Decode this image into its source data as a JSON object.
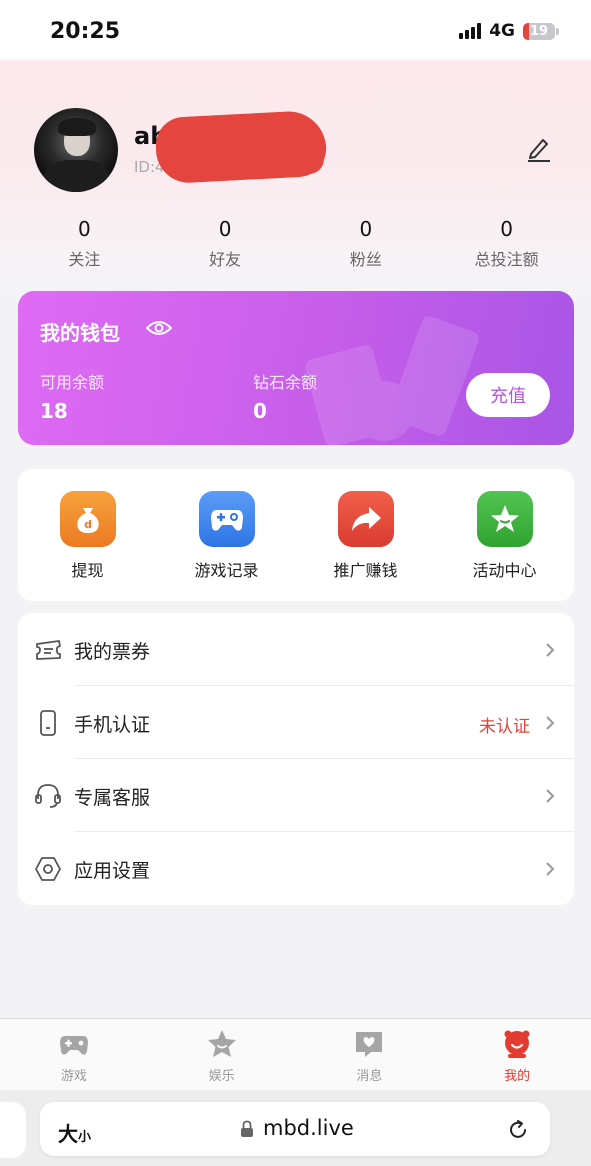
{
  "status_bar": {
    "time": "20:25",
    "network": "4G",
    "battery": "19",
    "battery_level": 0.19
  },
  "profile": {
    "username": "ab",
    "user_id": "ID:4"
  },
  "stats": [
    {
      "value": "0",
      "label": "关注"
    },
    {
      "value": "0",
      "label": "好友"
    },
    {
      "value": "0",
      "label": "粉丝"
    },
    {
      "value": "0",
      "label": "总投注额"
    }
  ],
  "wallet": {
    "title": "我的钱包",
    "available_label": "可用余额",
    "available_value": "18",
    "diamond_label": "钻石余额",
    "diamond_value": "0",
    "recharge_label": "充值"
  },
  "quick_actions": [
    {
      "label": "提现",
      "icon": "money-bag-icon",
      "color": "#f08a2a"
    },
    {
      "label": "游戏记录",
      "icon": "gamepad-icon",
      "color": "#3b82f0"
    },
    {
      "label": "推广赚钱",
      "icon": "share-arrow-icon",
      "color": "#e8473c"
    },
    {
      "label": "活动中心",
      "icon": "star-icon",
      "color": "#3db33d"
    }
  ],
  "menu": [
    {
      "label": "我的票券",
      "status": "",
      "icon": "ticket-icon"
    },
    {
      "label": "手机认证",
      "status": "未认证",
      "icon": "phone-icon"
    },
    {
      "label": "专属客服",
      "status": "",
      "icon": "headset-icon"
    },
    {
      "label": "应用设置",
      "status": "",
      "icon": "settings-icon"
    }
  ],
  "tabs": [
    {
      "label": "游戏",
      "icon": "gamepad-icon",
      "active": false
    },
    {
      "label": "娱乐",
      "icon": "star-icon",
      "active": false
    },
    {
      "label": "消息",
      "icon": "message-icon",
      "active": false
    },
    {
      "label": "我的",
      "icon": "profile-icon",
      "active": true
    }
  ],
  "browser": {
    "text_size_large": "大",
    "text_size_small": "小",
    "url": "mbd.live"
  },
  "colors": {
    "accent": "#e33b30",
    "wallet_start": "#df6bf4",
    "wallet_end": "#a855e6",
    "recharge_text": "#b455e6"
  }
}
